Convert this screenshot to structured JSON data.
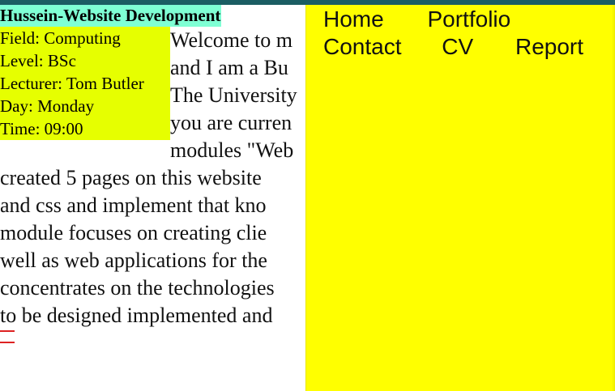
{
  "header": {
    "site_title": "Hussein-Website Development"
  },
  "module_info": {
    "field": "Field: Computing",
    "level": "Level: BSc",
    "lecturer": "Lecturer: Tom Butler",
    "day": "Day: Monday",
    "time": "Time: 09:00"
  },
  "intro": {
    "lines_beside": [
      "Welcome to m",
      "and I am a Bu",
      "The University",
      "you are curren",
      "modules \"Web"
    ],
    "lines_full": [
      "created 5 pages on this website",
      "and css and implement that kno",
      "module focuses on creating clie",
      "well as web applications for the",
      "concentrates on the technologies",
      "to be designed implemented and"
    ]
  },
  "nav": {
    "row1": [
      "Home",
      "Portfolio"
    ],
    "row2": [
      "Contact",
      "CV",
      "Report"
    ]
  },
  "colors": {
    "top_bar": "#1b5d63",
    "title_bg": "#7fffd4",
    "module_bg": "#e6ff00",
    "nav_bg": "#ffff00",
    "accent_mark": "#d22222"
  }
}
